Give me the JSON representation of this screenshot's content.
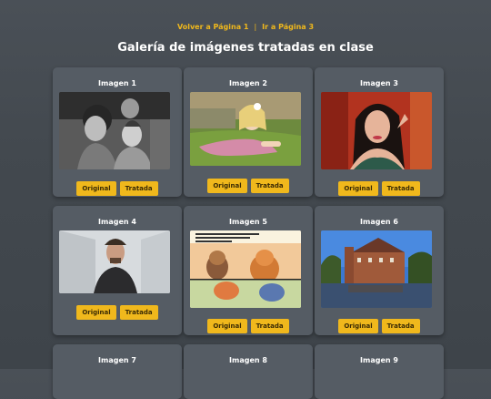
{
  "nav": {
    "back_label": "Volver a Página 1",
    "separator": "|",
    "next_label": "Ir a Página 3"
  },
  "page_title": "Galería de imágenes tratadas en clase",
  "buttons": {
    "original": "Original",
    "treated": "Tratada"
  },
  "cards": [
    {
      "caption": "Imagen 1",
      "picture": "vintage-family-photo"
    },
    {
      "caption": "Imagen 2",
      "picture": "girl-lying-in-grass"
    },
    {
      "caption": "Imagen 3",
      "picture": "woman-portrait-red-background"
    },
    {
      "caption": "Imagen 4",
      "picture": "man-in-white-room"
    },
    {
      "caption": "Imagen 5",
      "picture": "comic-strip-panel"
    },
    {
      "caption": "Imagen 6",
      "picture": "castle-by-water"
    },
    {
      "caption": "Imagen 7"
    },
    {
      "caption": "Imagen 8"
    },
    {
      "caption": "Imagen 9"
    }
  ],
  "colors": {
    "background": "#43494f",
    "card": "#555c64",
    "accent": "#f0b81c"
  }
}
